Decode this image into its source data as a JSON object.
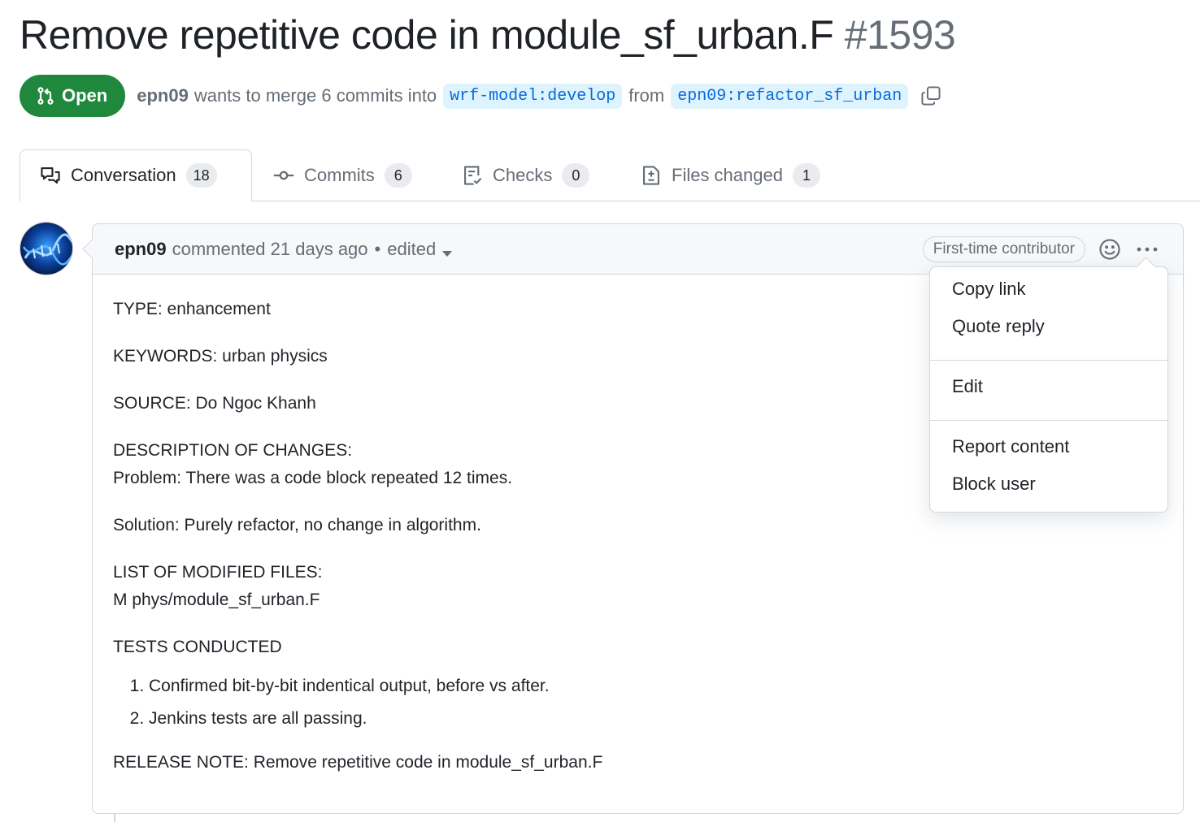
{
  "pr": {
    "title": "Remove repetitive code in module_sf_urban.F",
    "number": "#1593",
    "state": "Open",
    "author": "epn09",
    "merge_text": "wants to merge 6 commits into",
    "base_branch": "wrf-model:develop",
    "from_text": "from",
    "head_branch": "epn09:refactor_sf_urban"
  },
  "tabs": [
    {
      "label": "Conversation",
      "count": "18",
      "icon": "comment-discussion-icon"
    },
    {
      "label": "Commits",
      "count": "6",
      "icon": "git-commit-icon"
    },
    {
      "label": "Checks",
      "count": "0",
      "icon": "checklist-icon"
    },
    {
      "label": "Files changed",
      "count": "1",
      "icon": "file-diff-icon"
    }
  ],
  "comment": {
    "author": "epn09",
    "action": "commented 21 days ago",
    "dot": "•",
    "edited": "edited",
    "badge": "First-time contributor",
    "body": {
      "type": "TYPE: enhancement",
      "keywords": "KEYWORDS: urban physics",
      "source": "SOURCE: Do Ngoc Khanh",
      "description_heading": "DESCRIPTION OF CHANGES:",
      "problem": "Problem: There was a code block repeated 12 times.",
      "solution": "Solution: Purely refactor, no change in algorithm.",
      "files_heading": "LIST OF MODIFIED FILES:",
      "files": "M phys/module_sf_urban.F",
      "tests_heading": "TESTS CONDUCTED",
      "tests": [
        "Confirmed bit-by-bit indentical output, before vs after.",
        "Jenkins tests are all passing."
      ],
      "release_note": "RELEASE NOTE: Remove repetitive code in module_sf_urban.F"
    }
  },
  "menu": {
    "items": [
      "Copy link",
      "Quote reply",
      "Edit",
      "Report content",
      "Block user"
    ]
  },
  "colors": {
    "open_green": "#1f883d",
    "link_blue": "#0969da",
    "branch_bg": "#ddf4ff",
    "border": "#d0d7de",
    "muted": "#656d76"
  }
}
